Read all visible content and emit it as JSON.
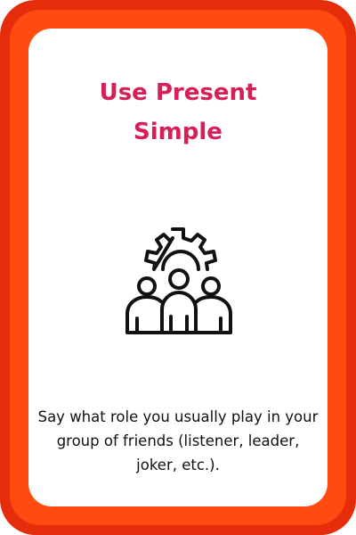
{
  "card": {
    "title_line1": "Use Present",
    "title_line2": "Simple",
    "icon": "team-gear-icon",
    "prompt": "Say what role you usually play in your group of friends (listener, leader, joker, etc.).",
    "colors": {
      "border_outer": "#e52d0b",
      "border_inner": "#ff4a10",
      "background": "#ffffff",
      "title": "#d81e56",
      "text": "#111111"
    }
  }
}
